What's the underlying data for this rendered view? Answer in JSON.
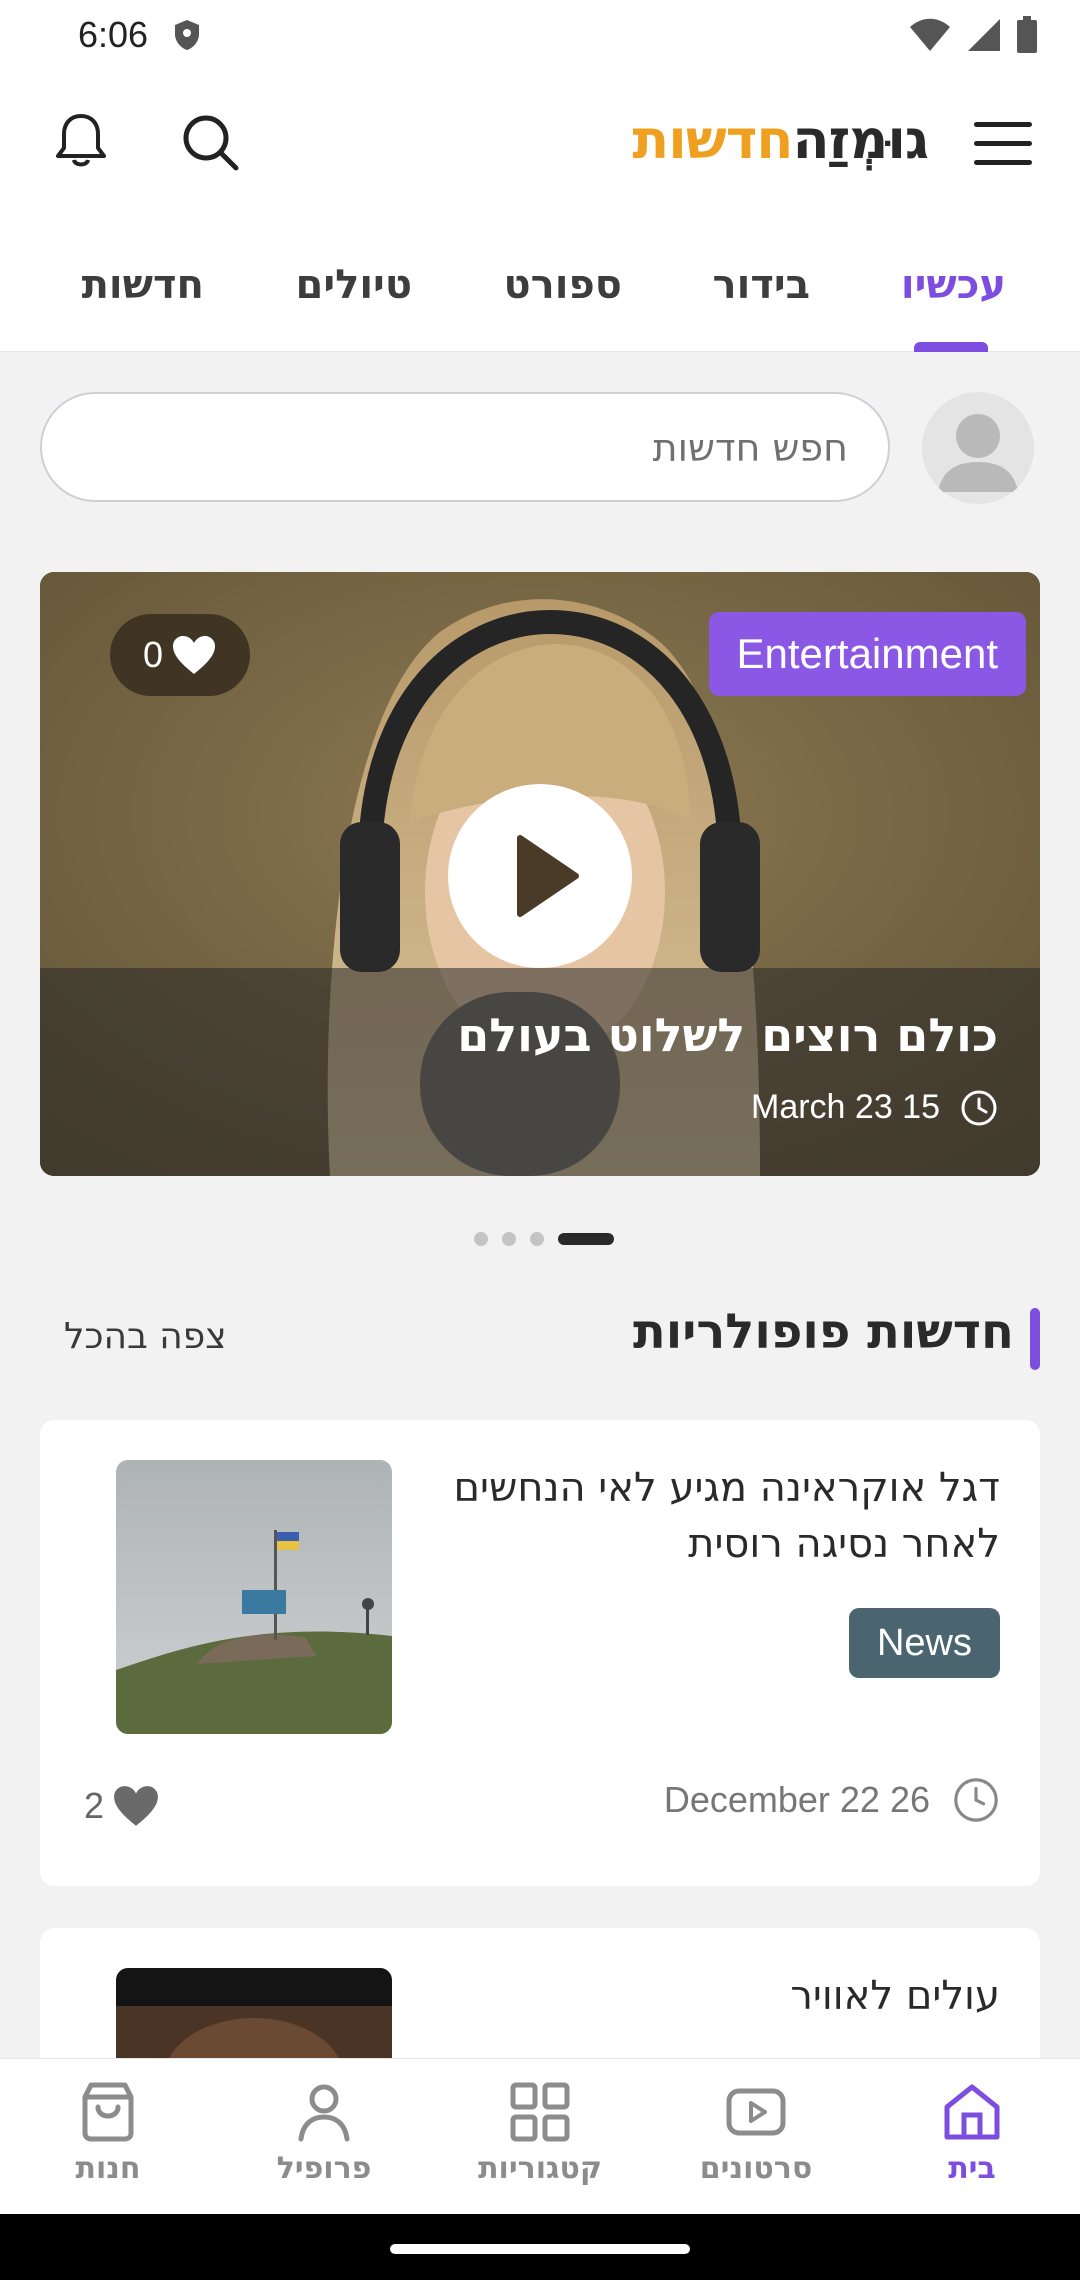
{
  "status_bar": {
    "time": "6:06"
  },
  "header": {
    "logo_part1": "גוּמְזַה",
    "logo_part2": "חדשות"
  },
  "tabs": [
    {
      "label": "עכשיו",
      "active": true
    },
    {
      "label": "בידור"
    },
    {
      "label": "ספורט"
    },
    {
      "label": "טיולים"
    },
    {
      "label": "חדשות"
    }
  ],
  "search": {
    "placeholder": "חפש חדשות"
  },
  "hero": {
    "likes": "0",
    "category": "Entertainment",
    "title": "כולם רוצים לשלוט בעולם",
    "date": "March 23 15",
    "slides": 4,
    "active_slide": 4
  },
  "section": {
    "title": "חדשות פופולריות",
    "see_all": "צפה בהכל"
  },
  "articles": [
    {
      "title": "דגל אוקראינה מגיע לאי הנחשים לאחר נסיגה רוסית",
      "category": "News",
      "date": "December 22 26",
      "likes": "2"
    },
    {
      "title": "עולים לאוויר"
    }
  ],
  "bottom_nav": [
    {
      "label": "בית",
      "active": true
    },
    {
      "label": "סרטונים"
    },
    {
      "label": "קטגוריות"
    },
    {
      "label": "פרופיל"
    },
    {
      "label": "חנות"
    }
  ],
  "colors": {
    "accent": "#7c4dde",
    "logo_orange": "#f0a020",
    "news_badge": "#4a6470",
    "category_badge": "#8a58e4"
  }
}
